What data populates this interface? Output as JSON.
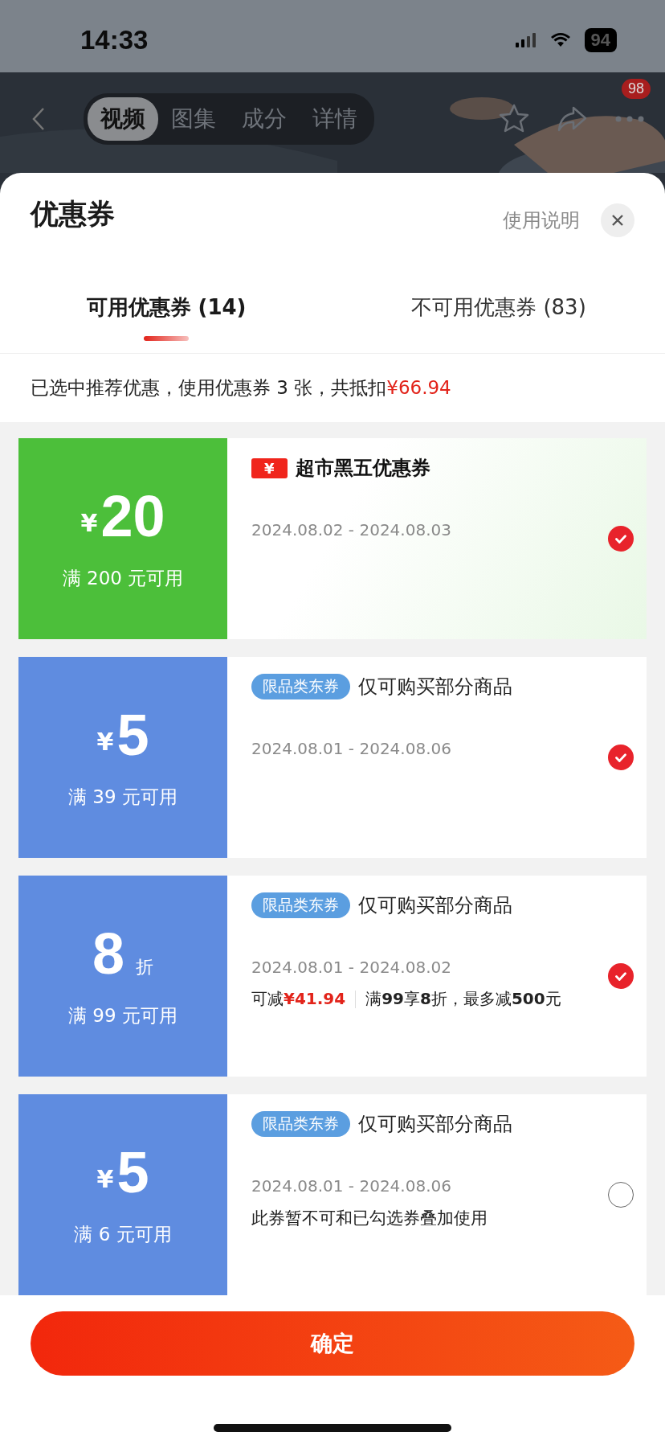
{
  "status_bar": {
    "time": "14:33",
    "battery": "94"
  },
  "top_nav": {
    "tabs": [
      {
        "label": "视频",
        "selected": true
      },
      {
        "label": "图集",
        "selected": false
      },
      {
        "label": "成分",
        "selected": false
      },
      {
        "label": "详情",
        "selected": false
      }
    ],
    "more_badge": "98"
  },
  "sheet": {
    "title": "优惠券",
    "help_link": "使用说明",
    "tabs": [
      {
        "label": "可用优惠券 (14)",
        "selected": true
      },
      {
        "label": "不可用优惠券 (83)",
        "selected": false
      }
    ],
    "summary": {
      "text": "已选中推荐优惠，使用优惠券 3 张，共抵扣",
      "amount": "¥66.94"
    },
    "coupons": [
      {
        "kind": "cash",
        "color": "#4cbf3a",
        "currency": "¥",
        "value": "20",
        "condition": "满 200 元可用",
        "header": {
          "kind": "event",
          "icon_text": "¥",
          "title": "超市黑五优惠券"
        },
        "dates": "2024.08.02 - 2024.08.03",
        "selected": true
      },
      {
        "kind": "cash",
        "color": "#5f8ce0",
        "currency": "¥",
        "value": "5",
        "condition": "满 39 元可用",
        "header": {
          "kind": "tag",
          "tag": "限品类东券",
          "title": "仅可购买部分商品"
        },
        "dates": "2024.08.01 - 2024.08.06",
        "selected": true
      },
      {
        "kind": "discount",
        "color": "#5f8ce0",
        "value": "8",
        "unit": "折",
        "condition": "满 99 元可用",
        "header": {
          "kind": "tag",
          "tag": "限品类东券",
          "title": "仅可购买部分商品"
        },
        "dates": "2024.08.01 - 2024.08.02",
        "saving_label": "可减",
        "saving": "¥41.94",
        "rule": "满**99**享**8**折，最多减**500**元",
        "selected": true
      },
      {
        "kind": "cash",
        "color": "#5f8ce0",
        "currency": "¥",
        "value": "5",
        "condition": "满 6 元可用",
        "header": {
          "kind": "tag",
          "tag": "限品类东券",
          "title": "仅可购买部分商品"
        },
        "dates": "2024.08.01 - 2024.08.06",
        "note": "此券暂不可和已勾选券叠加使用",
        "selected": false
      }
    ],
    "confirm_button": "确定"
  }
}
